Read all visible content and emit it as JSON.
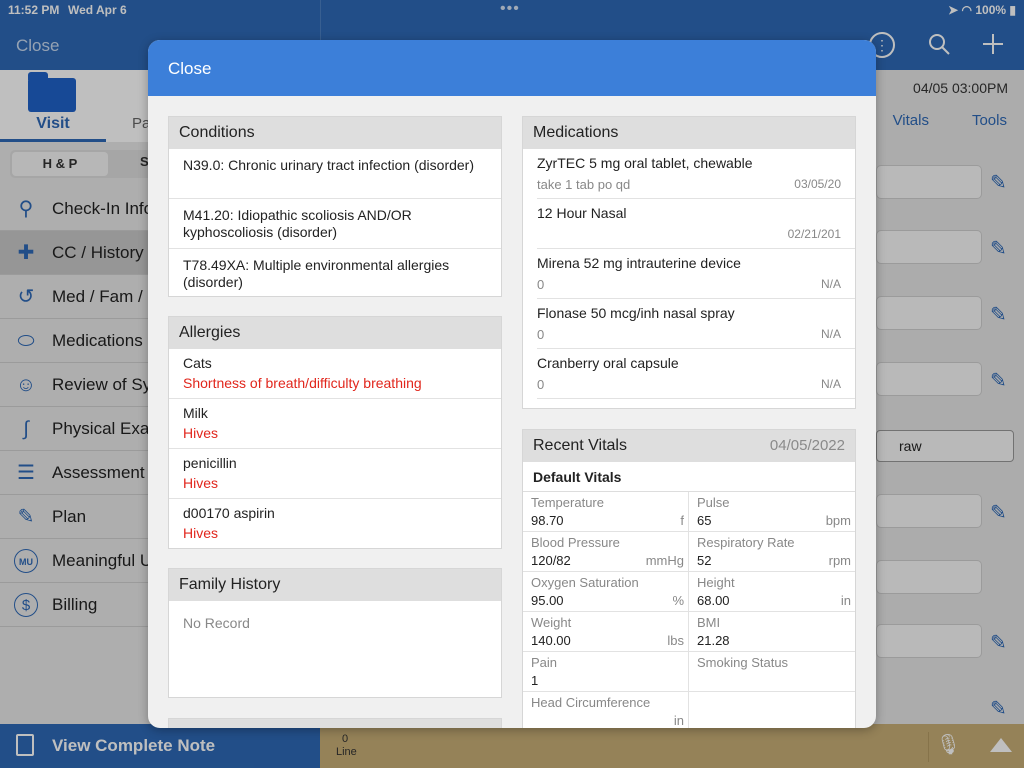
{
  "status_bar": {
    "time": "11:52 PM",
    "date": "Wed Apr 6",
    "battery": "100%"
  },
  "app": {
    "header_close": "Close",
    "tabs": {
      "visit": "Visit",
      "pa": "Pa"
    },
    "segment": {
      "hp": "H & P",
      "s": "S"
    },
    "nav": [
      {
        "label": "Check-In Info",
        "icon": "location-pin-icon"
      },
      {
        "label": "CC / History",
        "icon": "cross-icon"
      },
      {
        "label": "Med / Fam / S",
        "icon": "history-clock-icon"
      },
      {
        "label": "Medications",
        "icon": "pill-icon"
      },
      {
        "label": "Review of Sy",
        "icon": "person-icon"
      },
      {
        "label": "Physical Exam",
        "icon": "stethoscope-icon"
      },
      {
        "label": "Assessment",
        "icon": "clipboard-icon"
      },
      {
        "label": "Plan",
        "icon": "plan-icon"
      },
      {
        "label": "Meaningful U",
        "icon": "mu-icon"
      },
      {
        "label": "Billing",
        "icon": "dollar-icon"
      }
    ],
    "right": {
      "date": "04/05 03:00PM",
      "vitals": "Vitals",
      "tools": "Tools",
      "draw": "raw"
    },
    "bottom": {
      "view_note": "View Complete Note",
      "count": "0",
      "line": "Line"
    }
  },
  "modal": {
    "close_label": "Close",
    "conditions": {
      "title": "Conditions",
      "items": [
        "N39.0: Chronic urinary tract infection (disorder)",
        "M41.20: Idiopathic scoliosis AND/OR kyphoscoliosis (disorder)",
        "T78.49XA: Multiple environmental allergies (disorder)"
      ]
    },
    "allergies": {
      "title": "Allergies",
      "items": [
        {
          "name": "Cats",
          "reaction": "Shortness of breath/difficulty breathing"
        },
        {
          "name": "Milk",
          "reaction": "Hives"
        },
        {
          "name": "penicillin",
          "reaction": "Hives"
        },
        {
          "name": "d00170 aspirin",
          "reaction": "Hives"
        }
      ]
    },
    "family_history": {
      "title": "Family History",
      "empty": "No Record"
    },
    "medications": {
      "title": "Medications",
      "items": [
        {
          "name": "ZyrTEC 5 mg oral tablet, chewable",
          "sig": "take 1 tab po qd",
          "date": "03/05/20"
        },
        {
          "name": "12 Hour Nasal",
          "sig": "",
          "date": "02/21/201"
        },
        {
          "name": "Mirena 52 mg intrauterine device",
          "sig": "0",
          "date": "N/A"
        },
        {
          "name": "Flonase 50 mcg/inh nasal spray",
          "sig": "0",
          "date": "N/A"
        },
        {
          "name": "Cranberry oral capsule",
          "sig": "0",
          "date": "N/A"
        }
      ]
    },
    "recent_vitals": {
      "title": "Recent Vitals",
      "date": "04/05/2022",
      "group": "Default Vitals",
      "rows": [
        [
          {
            "label": "Temperature",
            "value": "98.70",
            "unit": "f"
          },
          {
            "label": "Pulse",
            "value": "65",
            "unit": "bpm"
          }
        ],
        [
          {
            "label": "Blood Pressure",
            "value": "120/82",
            "unit": "mmHg"
          },
          {
            "label": "Respiratory Rate",
            "value": "52",
            "unit": "rpm"
          }
        ],
        [
          {
            "label": "Oxygen Saturation",
            "value": "95.00",
            "unit": "%"
          },
          {
            "label": "Height",
            "value": "68.00",
            "unit": "in"
          }
        ],
        [
          {
            "label": "Weight",
            "value": "140.00",
            "unit": "lbs"
          },
          {
            "label": "BMI",
            "value": "21.28",
            "unit": ""
          }
        ],
        [
          {
            "label": "Pain",
            "value": "1",
            "unit": ""
          },
          {
            "label": "Smoking Status",
            "value": "",
            "unit": ""
          }
        ],
        [
          {
            "label": "Head Circumference",
            "value": "",
            "unit": "in"
          },
          {
            "label": "",
            "value": "",
            "unit": ""
          }
        ]
      ]
    }
  },
  "colors": {
    "primary": "#2e69b6",
    "modal_header": "#3c7fd9",
    "reaction_red": "#e1261c",
    "bottom_gold": "#c7ae76"
  }
}
